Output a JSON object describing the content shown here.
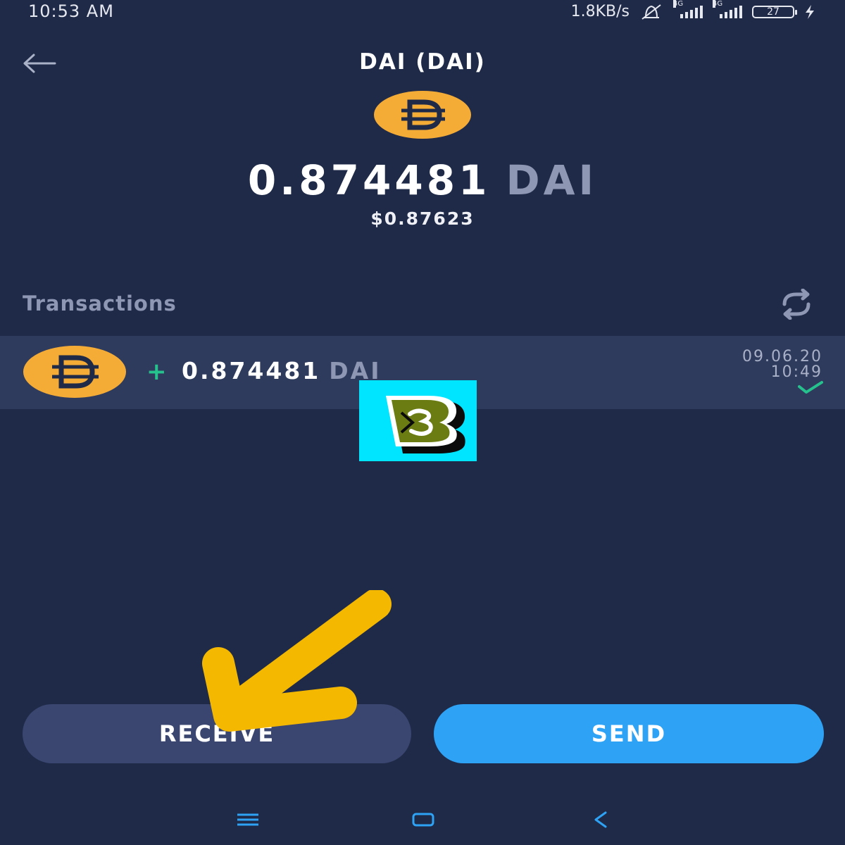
{
  "status_bar": {
    "time": "10:53 AM",
    "network_speed": "1.8KB/s",
    "mute_icon": "bell-off-icon",
    "network_type_1": "4G",
    "network_type_2": "4G",
    "battery_level": "27"
  },
  "header": {
    "back_icon": "back-arrow-icon",
    "title": "DAI (DAI)",
    "coin_icon": "dai-coin-icon"
  },
  "balance": {
    "amount": "0.874481",
    "symbol": "DAI",
    "fiat": "$0.87623"
  },
  "transactions": {
    "heading": "Transactions",
    "refresh_icon": "refresh-icon",
    "items": [
      {
        "sign": "+",
        "amount": "0.874481",
        "symbol": "DAI",
        "date": "09.06.20",
        "time": "10:49",
        "status_icon": "checkmark-icon"
      }
    ]
  },
  "actions": {
    "receive_label": "RECEIVE",
    "send_label": "SEND"
  },
  "colors": {
    "background": "#1f2a48",
    "accent_send": "#2ea2f5",
    "receive_button": "#3a4670",
    "coin": "#f5ac37",
    "positive": "#25c28e",
    "annotation_arrow": "#f5b800",
    "logo_bg": "#00e5ff"
  },
  "nav_bar": {
    "menu_icon": "menu-icon",
    "home_icon": "home-icon",
    "back_icon": "nav-back-icon"
  }
}
